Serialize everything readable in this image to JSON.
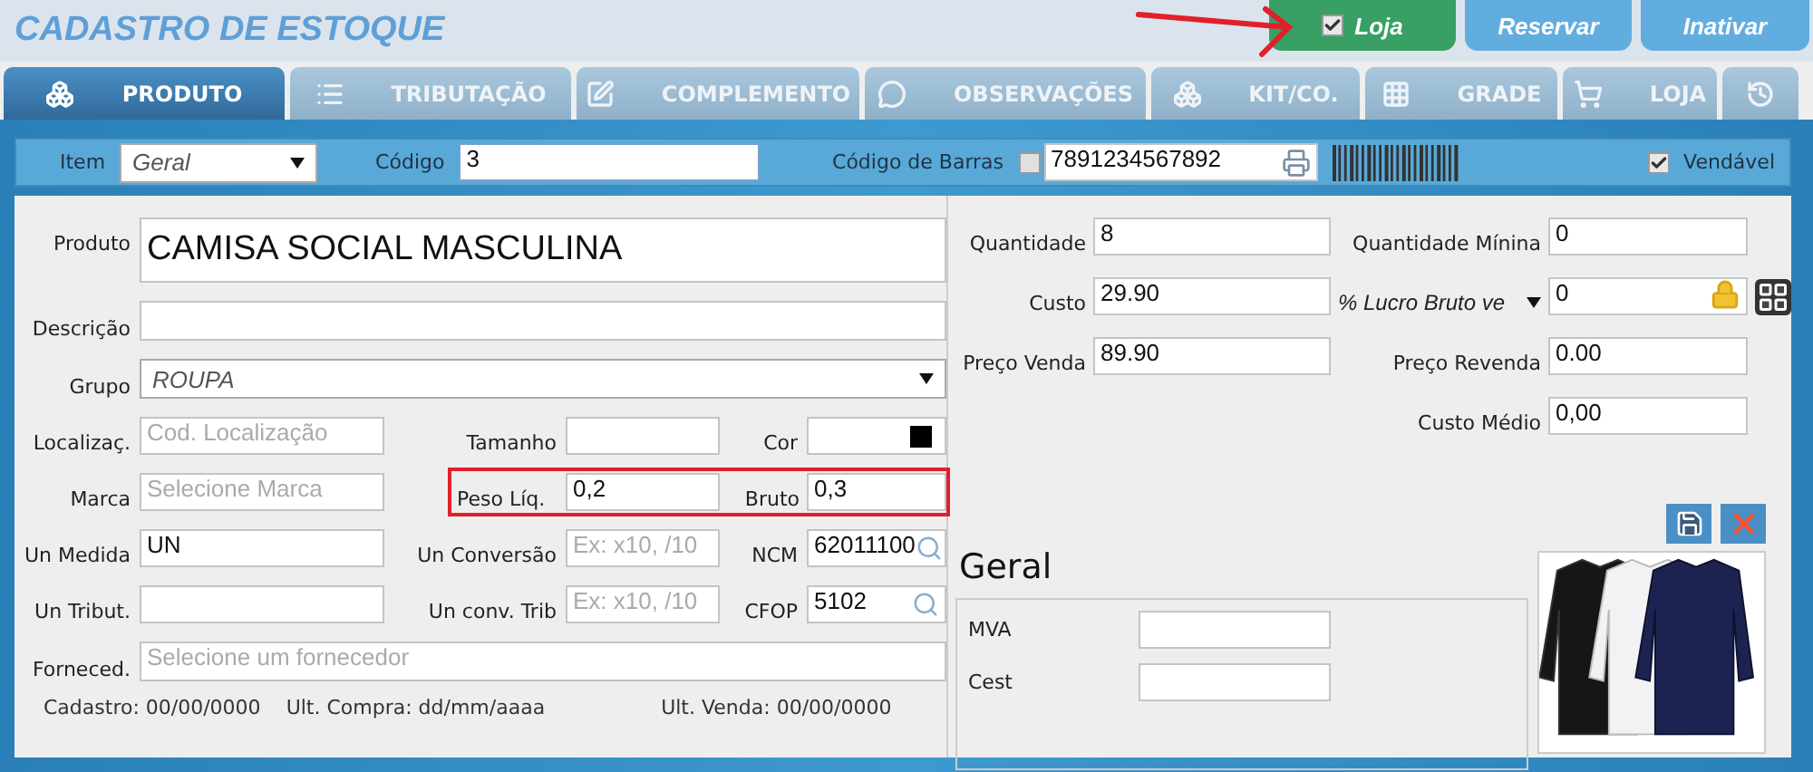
{
  "header": {
    "title": "CADASTRO DE ESTOQUE",
    "buttons": [
      {
        "label": "Loja",
        "kind": "toggle",
        "checked": true
      },
      {
        "label": "Reservar",
        "kind": "action"
      },
      {
        "label": "Inativar",
        "kind": "action"
      }
    ]
  },
  "tabs": [
    {
      "label": "PRODUTO",
      "selected": true
    },
    {
      "label": "TRIBUTAÇÃO",
      "selected": false
    },
    {
      "label": "COMPLEMENTO",
      "selected": false
    },
    {
      "label": "OBSERVAÇÕES",
      "selected": false
    },
    {
      "label": "KIT/CO.",
      "selected": false
    },
    {
      "label": "GRADE",
      "selected": false
    },
    {
      "label": "LOJA",
      "selected": false
    },
    {
      "selected": false
    }
  ],
  "toolbar": {
    "item_label": "Item",
    "item_value": "Geral",
    "code_label": "Código",
    "code_value": "3",
    "barcode_label": "Código de Barras",
    "barcode_checked": false,
    "barcode_value": "7891234567892",
    "sellable_label": "Vendável",
    "sellable_checked": true
  },
  "left_rows": [
    {
      "fields": [
        {
          "label": "Produto",
          "kind": "large",
          "value": "CAMISA SOCIAL MASCULINA"
        }
      ]
    },
    {
      "fields": [
        {
          "label": "Descrição",
          "kind": "text"
        }
      ]
    },
    {
      "fields": [
        {
          "label": "Grupo",
          "kind": "select",
          "value": "ROUPA"
        }
      ]
    },
    {
      "highlight": false,
      "fields": [
        {
          "label": "Localizaç.",
          "kind": "text",
          "placeholder": "Cod. Localização"
        },
        {
          "label": "Tamanho",
          "kind": "text"
        },
        {
          "label": "Cor",
          "kind": "color",
          "color": "#000000"
        }
      ]
    },
    {
      "highlight": true,
      "fields": [
        {
          "label": "Marca",
          "kind": "text",
          "placeholder": "Selecione Marca"
        },
        {
          "label": "Peso Líq.",
          "kind": "text",
          "value": "0,2"
        },
        {
          "label": "Bruto",
          "kind": "text",
          "value": "0,3"
        }
      ]
    },
    {
      "highlight": false,
      "fields": [
        {
          "label": "Un Medida",
          "kind": "text",
          "value": "UN"
        },
        {
          "label": "Un Conversão",
          "kind": "text",
          "placeholder": "Ex: x10, /10"
        },
        {
          "label": "NCM",
          "kind": "search",
          "value": "62011100"
        }
      ]
    },
    {
      "highlight": false,
      "fields": [
        {
          "label": "Un Tribut.",
          "kind": "text"
        },
        {
          "label": "Un conv. Trib",
          "kind": "text",
          "placeholder": "Ex: x10, /10"
        },
        {
          "label": "CFOP",
          "kind": "search",
          "value": "5102"
        }
      ]
    },
    {
      "fields": [
        {
          "label": "Forneced.",
          "kind": "text",
          "placeholder": "Selecione um fornecedor"
        }
      ]
    }
  ],
  "dates": [
    "Cadastro: 00/00/0000",
    "Ult. Compra:  dd/mm/aaaa",
    "Ult. Venda: 00/00/0000"
  ],
  "right_rows": [
    {
      "fields": [
        {
          "label": "Quantidade",
          "kind": "text",
          "value": "8"
        },
        {
          "label": "Quantidade Mínina",
          "kind": "text",
          "value": "0"
        }
      ]
    },
    {
      "fields": [
        {
          "label": "Custo",
          "kind": "text",
          "value": "29.90"
        },
        {
          "label": "% Lucro Bruto ve",
          "kind": "select-label",
          "value": "0"
        }
      ]
    },
    {
      "fields": [
        {
          "label": "Preço Venda",
          "kind": "text",
          "value": "89.90"
        },
        {
          "label": "Preço Revenda",
          "kind": "text",
          "value": "0.00"
        }
      ]
    },
    {
      "fields": [
        {
          "label": "Custo Médio",
          "kind": "text",
          "value": "0,00"
        }
      ]
    }
  ],
  "taxes": {
    "title": "Geral",
    "fields": [
      {
        "label": "MVA"
      },
      {
        "label": "Cest"
      }
    ]
  },
  "image": {
    "kind": "picture"
  }
}
